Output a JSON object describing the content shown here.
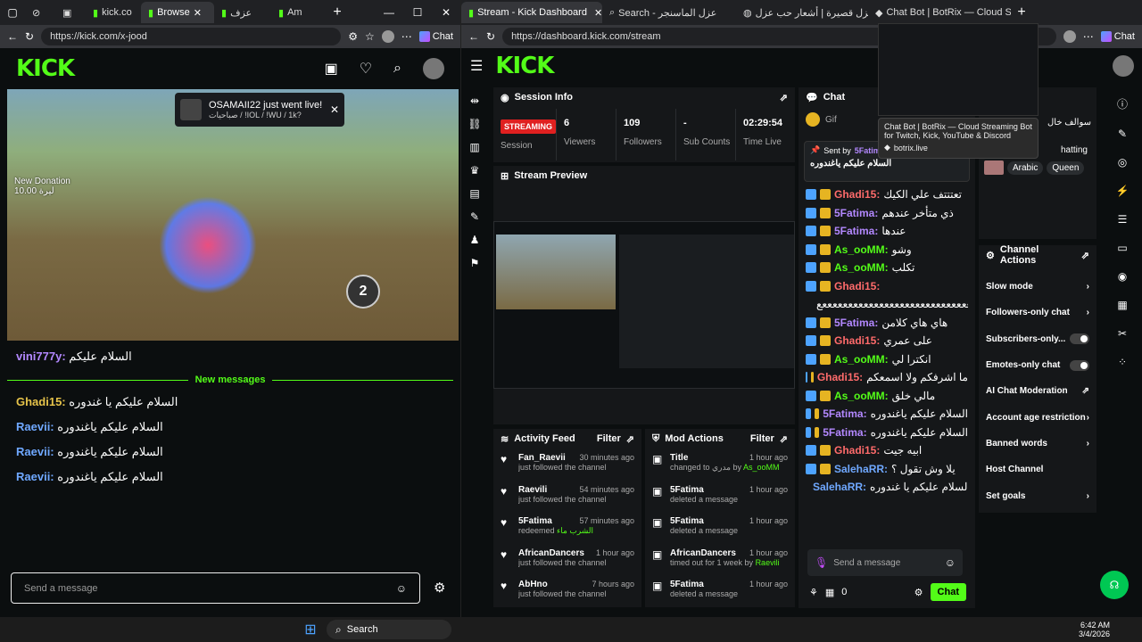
{
  "left_browser": {
    "tabs": [
      {
        "label": "kick.co"
      },
      {
        "label": "Browse"
      },
      {
        "label": "عزف"
      },
      {
        "label": "Am"
      }
    ],
    "url": "https://kick.com/x-jood",
    "chat_btn": "Chat"
  },
  "right_browser": {
    "tabs": [
      {
        "label": "Stream - Kick Dashboard"
      },
      {
        "label": "Search - عزل الماسنجر"
      },
      {
        "label": "أبيات عزل قصيرة | أشعار حب عزل"
      },
      {
        "label": "Chat Bot | BotRix — Cloud Stre"
      }
    ],
    "url": "https://dashboard.kick.com/stream",
    "chat_btn": "Chat"
  },
  "tooltip": {
    "title": "Chat Bot | BotRix — Cloud Streaming Bot for Twitch, Kick, YouTube & Discord",
    "domain": "botrix.live"
  },
  "left_page": {
    "logo": "KICK",
    "notify": {
      "title": "OSAMAII22 just went live!",
      "sub": "صباحيات / !IOL / !WU / 1k?"
    },
    "video_overlay": {
      "new_donation": "New Donation",
      "donation_amount": "ليرة 10.00",
      "timer": "2"
    },
    "pinned": {
      "user": "vini777y:",
      "text": "السلام عليكم"
    },
    "new_messages": "New messages",
    "messages": [
      {
        "user": "Ghadi15:",
        "text": "السلام عليكم يا غندوره",
        "color": "#e6c34a"
      },
      {
        "user": "Raevii:",
        "text": "السلام عليكم ياغندوره",
        "color": "#6fa8ff"
      },
      {
        "user": "Raevii:",
        "text": "السلام عليكم ياغندوره",
        "color": "#6fa8ff"
      },
      {
        "user": "Raevii:",
        "text": "السلام عليكم ياغندوره",
        "color": "#6fa8ff"
      }
    ],
    "input_placeholder": "Send a message"
  },
  "dashboard": {
    "logo": "KICK",
    "session": {
      "title": "Session Info",
      "status": "STREAMING",
      "status_label": "Session",
      "stats": [
        {
          "value": "6",
          "label": "Viewers"
        },
        {
          "value": "109",
          "label": "Followers"
        },
        {
          "value": "-",
          "label": "Sub Counts"
        },
        {
          "value": "02:29:54",
          "label": "Time Live"
        }
      ]
    },
    "preview": {
      "title": "Stream Preview"
    },
    "activity": {
      "title": "Activity Feed",
      "filter": "Filter",
      "items": [
        {
          "user": "Fan_Raevii",
          "time": "30 minutes ago",
          "desc": "just followed the channel",
          "extra": ""
        },
        {
          "user": "Raevili",
          "time": "54 minutes ago",
          "desc": "just followed the channel",
          "extra": ""
        },
        {
          "user": "5Fatima",
          "time": "57 minutes ago",
          "desc": "redeemed",
          "extra": "الشرب ماء"
        },
        {
          "user": "AfricanDancers",
          "time": "1 hour ago",
          "desc": "just followed the channel",
          "extra": ""
        },
        {
          "user": "AbHno",
          "time": "7 hours ago",
          "desc": "just followed the channel",
          "extra": ""
        }
      ]
    },
    "mod": {
      "title": "Mod Actions",
      "filter": "Filter",
      "items": [
        {
          "user": "Title",
          "time": "1 hour ago",
          "desc": "changed to مدري by",
          "extra": "As_ooMM"
        },
        {
          "user": "5Fatima",
          "time": "1 hour ago",
          "desc": "deleted a message",
          "extra": ""
        },
        {
          "user": "5Fatima",
          "time": "1 hour ago",
          "desc": "deleted a message",
          "extra": ""
        },
        {
          "user": "AfricanDancers",
          "time": "1 hour ago",
          "desc": "timed out for 1 week by",
          "extra": "Raevili"
        },
        {
          "user": "5Fatima",
          "time": "1 hour ago",
          "desc": "deleted a message",
          "extra": ""
        }
      ]
    },
    "chat": {
      "title": "Chat",
      "gift_label": "Gif",
      "pinned_by": "Sent by",
      "pinned_user": "5Fatima",
      "pinned_text": "السلام عليكم ياغندوره",
      "lines": [
        {
          "user": "Ghadi15:",
          "text": "تعتتتف علي الكيك",
          "color": "#ff6b6b"
        },
        {
          "user": "5Fatima:",
          "text": "ذي متأخر عندهم",
          "color": "#b388ff"
        },
        {
          "user": "5Fatima:",
          "text": "عندها",
          "color": "#b388ff"
        },
        {
          "user": "As_ooMM:",
          "text": "وشو",
          "color": "#53fc18"
        },
        {
          "user": "As_ooMM:",
          "text": "تكلب",
          "color": "#53fc18"
        },
        {
          "user": "Ghadi15:",
          "text": "",
          "color": "#ff6b6b"
        },
        {
          "user": "",
          "text": "ععععععععععععععععععععععععععععععععع",
          "color": "#fff"
        },
        {
          "user": "5Fatima:",
          "text": "هاي هاي كلامن",
          "color": "#b388ff"
        },
        {
          "user": "Ghadi15:",
          "text": "على عمري",
          "color": "#ff6b6b"
        },
        {
          "user": "As_ooMM:",
          "text": "انكترا لي",
          "color": "#53fc18"
        },
        {
          "user": "Ghadi15:",
          "text": "ما اشرفكم ولا اسمعكم",
          "color": "#ff6b6b"
        },
        {
          "user": "As_ooMM:",
          "text": "مالي خلق",
          "color": "#53fc18"
        },
        {
          "user": "5Fatima:",
          "text": "السلام عليكم ياغندوره",
          "color": "#b388ff"
        },
        {
          "user": "5Fatima:",
          "text": "السلام عليكم ياغندوره",
          "color": "#b388ff"
        },
        {
          "user": "Ghadi15:",
          "text": "ابيه جيت",
          "color": "#ff6b6b"
        },
        {
          "user": "SalehaRR:",
          "text": "يلا وش تقول ؟",
          "color": "#6fa8ff"
        },
        {
          "user": "SalehaRR:",
          "text": "السلام عليكم يا غندوره",
          "color": "#6fa8ff"
        }
      ],
      "input_placeholder": "Send a message",
      "points": "0",
      "chat_button": "Chat"
    },
    "right_panel": {
      "header_text": "سوالف خال",
      "tags_label": "hatting",
      "tags": [
        "Arabic",
        "Queen"
      ],
      "actions_title": "Channel Actions",
      "actions": [
        {
          "label": "Slow mode",
          "control": "chevron"
        },
        {
          "label": "Followers-only chat",
          "control": "chevron"
        },
        {
          "label": "Subscribers-only...",
          "control": "toggle"
        },
        {
          "label": "Emotes-only chat",
          "control": "toggle"
        },
        {
          "label": "AI Chat Moderation",
          "control": "ext"
        },
        {
          "label": "Account age restriction",
          "control": "chevron"
        },
        {
          "label": "Banned words",
          "control": "chevron"
        },
        {
          "label": "Host Channel",
          "control": "none"
        },
        {
          "label": "Set goals",
          "control": "chevron"
        }
      ]
    }
  },
  "taskbar": {
    "search": "Search",
    "time": "6:42 AM",
    "date": "3/4/2026"
  }
}
